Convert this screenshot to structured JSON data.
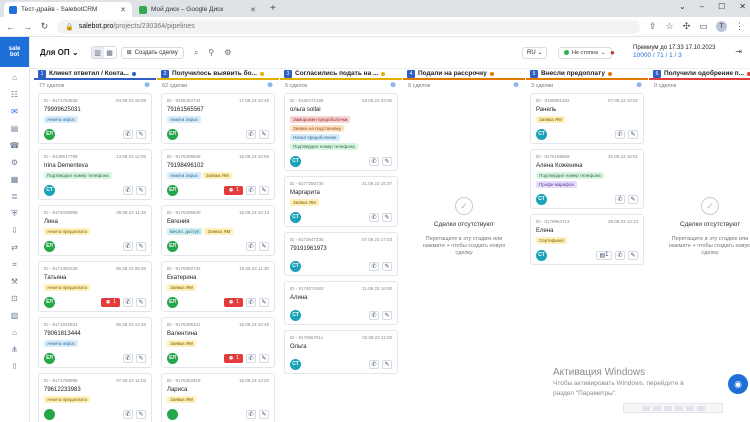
{
  "browser": {
    "tabs": [
      {
        "title": "Тест-драйв - SalebotCRM",
        "active": true,
        "favicon_color": "#1f6fd8"
      },
      {
        "title": "Мой диск – Google Диск",
        "active": false,
        "favicon_color": "#34a853"
      }
    ],
    "new_tab": "+",
    "url_host": "salebot.pro",
    "url_path": "/projects/230364/pipelines",
    "profile_initial": "T"
  },
  "sidebar": {
    "logo_line1": "sale",
    "logo_line2": "bot",
    "icons": [
      "home-icon",
      "people-icon",
      "chat-icon",
      "wallet-icon",
      "contacts-icon",
      "settings-icon",
      "grid-icon",
      "list-icon",
      "shield-icon",
      "download-icon",
      "transfer-icon",
      "code-icon",
      "tools-icon",
      "cart-icon",
      "chart-icon",
      "store-icon",
      "hierarchy-icon",
      "upload-icon"
    ]
  },
  "topbar": {
    "pipeline": "Для ОП",
    "create_deal": "Создать сделку",
    "lang": "RU",
    "status": "Не стопна",
    "premium_line1": "Премиум до 17.33 17.10.2023",
    "premium_line2": "10000 / 71 / 1 / 3"
  },
  "empty_state": {
    "title": "Сделки отсутствуют",
    "hint": "Перетащите в эту стадию или нажмите + чтобы создать новую сделку"
  },
  "columns": [
    {
      "num": "1",
      "title": "Клиент ответил / Конта...",
      "count": "77 сделок",
      "dot": "#2f5fc4",
      "underline": "#2f5fc4",
      "cards": [
        {
          "id": "ID - 8171764938",
          "date": "04.09.23 16:08",
          "name": "79999625031",
          "tags": [
            {
              "t": "Анкета опрос",
              "c": "blue"
            }
          ],
          "avatar": "ЕЛ",
          "green": true
        },
        {
          "id": "ID - 8149517799",
          "date": "13.08.23 12:05",
          "name": "Irina Dementeva",
          "tags": [
            {
              "t": "Подтвердил номер телефона",
              "c": "green"
            }
          ],
          "avatar": "СТ",
          "green": false
        },
        {
          "id": "ID - 8172039988",
          "date": "06.08.23 11:26",
          "name": "Лина",
          "tags": [
            {
              "t": "Анкета предоплата",
              "c": "yellow"
            }
          ],
          "avatar": "ЕЛ",
          "green": true
        },
        {
          "id": "ID - 8171360226",
          "date": "06.08.23 06:36",
          "name": "Татьяна",
          "tags": [
            {
              "t": "Анкета предоплата",
              "c": "yellow"
            }
          ],
          "avatar": "ЕЛ",
          "green": true,
          "badge": "1"
        },
        {
          "id": "ID - 8171642831",
          "date": "06.08.23 12:46",
          "name": "79061813444",
          "tags": [
            {
              "t": "Анкета опрос",
              "c": "blue"
            }
          ],
          "avatar": "ЕЛ",
          "green": true
        },
        {
          "id": "ID - 8171766898",
          "date": "07.08.23 11:03",
          "name": "79612233983",
          "tags": [
            {
              "t": "Анкета предоплата",
              "c": "yellow"
            }
          ],
          "avatar": "",
          "green": true
        }
      ]
    },
    {
      "num": "2",
      "title": "Получилось выявить бо...",
      "count": "62 сделки",
      "dot": "#e0b000",
      "underline": "#e0b000",
      "cards": [
        {
          "id": "ID - 8185453744",
          "date": "17.08.23 10:45",
          "name": "79161565567",
          "tags": [
            {
              "t": "Анкета опрос",
              "c": "blue"
            }
          ],
          "avatar": "ЕЛ",
          "green": true
        },
        {
          "id": "ID - 8175309638",
          "date": "15.08.23 10:59",
          "name": "79198496102",
          "tags": [
            {
              "t": "Анкета опрос",
              "c": "blue"
            },
            {
              "t": "Заявка ЯМ",
              "c": "yellow"
            }
          ],
          "avatar": "ЕЛ",
          "green": true,
          "badge": "1"
        },
        {
          "id": "ID - 8175286640",
          "date": "15.08.23 10:13",
          "name": "Евгения",
          "tags": [
            {
              "t": "Беспл. доступ",
              "c": "teal"
            },
            {
              "t": "Заявка ЯМ",
              "c": "yellow"
            }
          ],
          "avatar": "ЕЛ",
          "green": true
        },
        {
          "id": "ID - 8175300732",
          "date": "15.08.23 11:30",
          "name": "Екатерина",
          "tags": [
            {
              "t": "Заявка ЯМ",
              "c": "yellow"
            }
          ],
          "avatar": "ЕЛ",
          "green": true,
          "badge": "1"
        },
        {
          "id": "ID - 8175305341",
          "date": "15.08.23 10:45",
          "name": "Валентина",
          "tags": [
            {
              "t": "Заявка ЯМ",
              "c": "yellow"
            }
          ],
          "avatar": "ЕЛ",
          "green": true,
          "badge": "1"
        },
        {
          "id": "ID - 8175302618",
          "date": "15.08.23 13:20",
          "name": "Лариса",
          "tags": [
            {
              "t": "Заявка ЯМ",
              "c": "yellow"
            }
          ],
          "avatar": "",
          "green": true
        }
      ]
    },
    {
      "num": "3",
      "title": "Согласились подать на ...",
      "count": "5 сделок",
      "dot": "#e0b000",
      "underline": "#e0b000",
      "cards": [
        {
          "id": "ID - 8180472185",
          "date": "03.09.23 03:06",
          "name": "ольга sollai",
          "tags": [
            {
              "t": "Заморожен предоболочки",
              "c": "red"
            },
            {
              "t": "Заявка на подстановку",
              "c": "orange"
            },
            {
              "t": "Начал предоб-ление",
              "c": "blue"
            },
            {
              "t": "Подтвердил номер телефона",
              "c": "green"
            }
          ],
          "avatar": "СТ",
          "green": false
        },
        {
          "id": "ID - 8177350730",
          "date": "21.09.23 15:37",
          "name": "Маргарита",
          "tags": [
            {
              "t": "Заявка ЯМ",
              "c": "yellow"
            }
          ],
          "avatar": "СТ",
          "green": false
        },
        {
          "id": "ID - 8173847235",
          "date": "07.09.23 17:03",
          "name": "79191961973",
          "tags": [],
          "avatar": "СТ",
          "green": false
        },
        {
          "id": "ID - 8174074183",
          "date": "11.09.23 16:00",
          "name": "Алина",
          "tags": [],
          "avatar": "СТ",
          "green": false
        },
        {
          "id": "ID - 8170667611",
          "date": "02.09.23 11:00",
          "name": "Ольга",
          "tags": [],
          "avatar": "СТ",
          "green": false
        }
      ]
    },
    {
      "num": "4",
      "title": "Подали на рассрочку",
      "count": "0 сделок",
      "dot": "#e07a00",
      "underline": "#e07a00",
      "cards": [],
      "empty": true
    },
    {
      "num": "5",
      "title": "Внесли предоплату",
      "count": "3 сделки",
      "dot": "#e07a00",
      "underline": "#e07a00",
      "cards": [
        {
          "id": "ID - 8168881382",
          "date": "07.09.23 13:02",
          "name": "Ранель",
          "tags": [
            {
              "t": "Заявка ЯМ",
              "c": "yellow"
            }
          ],
          "avatar": "СТ",
          "green": false
        },
        {
          "id": "ID - 8176168659",
          "date": "20.09.23 16:01",
          "name": "Алена Коженина",
          "tags": [
            {
              "t": "Подтвердил номер телефона",
              "c": "green"
            },
            {
              "t": "Профи марафон",
              "c": "purple"
            }
          ],
          "avatar": "СТ",
          "green": false
        },
        {
          "id": "ID - 8179964713",
          "date": "28.09.23 13:13",
          "name": "Елена",
          "tags": [
            {
              "t": "Сертификат",
              "c": "yellow"
            }
          ],
          "avatar": "СТ",
          "green": false,
          "box": "1"
        }
      ]
    },
    {
      "num": "6",
      "title": "Получили одобрение п...",
      "count": "0 сделок",
      "dot": "#e23c3c",
      "underline": "#e23c3c",
      "cards": [],
      "empty": true
    }
  ],
  "tag_colors": {
    "blue": {
      "bg": "#d6ecfb",
      "fg": "#2b5f8a"
    },
    "green": {
      "bg": "#d8f5e3",
      "fg": "#2a6b45"
    },
    "yellow": {
      "bg": "#fdf0b8",
      "fg": "#7a5e00"
    },
    "teal": {
      "bg": "#cdeff2",
      "fg": "#21656c"
    },
    "red": {
      "bg": "#f9d3d3",
      "fg": "#8a2b2b"
    },
    "orange": {
      "bg": "#fde2c6",
      "fg": "#8a4b12"
    },
    "purple": {
      "bg": "#e6dcfa",
      "fg": "#5b3d94"
    }
  },
  "windows_activation": {
    "title": "Активация Windows",
    "text1": "Чтобы активировать Windows, перейдите в",
    "text2": "раздел \"Параметры\"."
  }
}
